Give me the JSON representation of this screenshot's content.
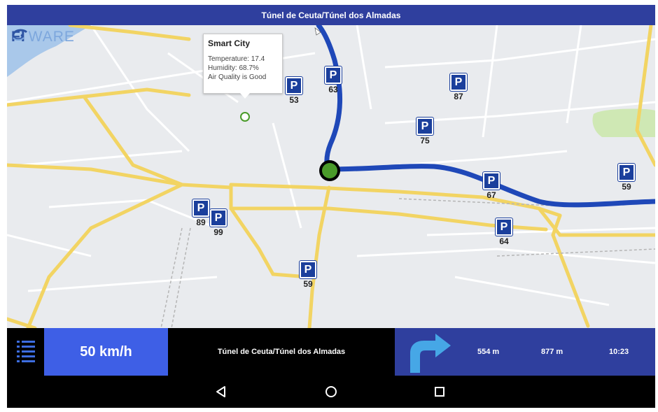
{
  "title": "Túnel de Ceuta/Túnel dos Almadas",
  "logo": {
    "prefix": "FI",
    "suffix": "WARE"
  },
  "popup": {
    "title": "Smart City",
    "temperature": "Temperature: 17.4",
    "humidity": "Humidity: 68.7%",
    "air_quality": "Air Quality is Good"
  },
  "parking": [
    {
      "label": "P",
      "count": "63"
    },
    {
      "label": "P",
      "count": "53"
    },
    {
      "label": "P",
      "count": "87"
    },
    {
      "label": "P",
      "count": "75"
    },
    {
      "label": "P",
      "count": "67"
    },
    {
      "label": "P",
      "count": "59"
    },
    {
      "label": "P",
      "count": "89"
    },
    {
      "label": "P",
      "count": "99"
    },
    {
      "label": "P",
      "count": "64"
    },
    {
      "label": "P",
      "count": "59"
    }
  ],
  "bottom": {
    "speed": "50 km/h",
    "street": "Túnel de Ceuta/Túnel dos Almadas",
    "next_turn_distance": "554 m",
    "remaining_distance": "877 m",
    "eta": "10:23"
  },
  "colors": {
    "title_bar": "#2f3f9e",
    "speed_panel": "#3e5fe6",
    "route": "#1f48b8",
    "road": "#f2d463",
    "parking": "#1b3f9c",
    "turn_arrow": "#46a7e6"
  },
  "icons": [
    "menu-list-icon",
    "turn-right-arrow-icon",
    "back-icon",
    "home-icon",
    "recents-icon",
    "sensor-marker-icon",
    "location-dot-icon"
  ]
}
